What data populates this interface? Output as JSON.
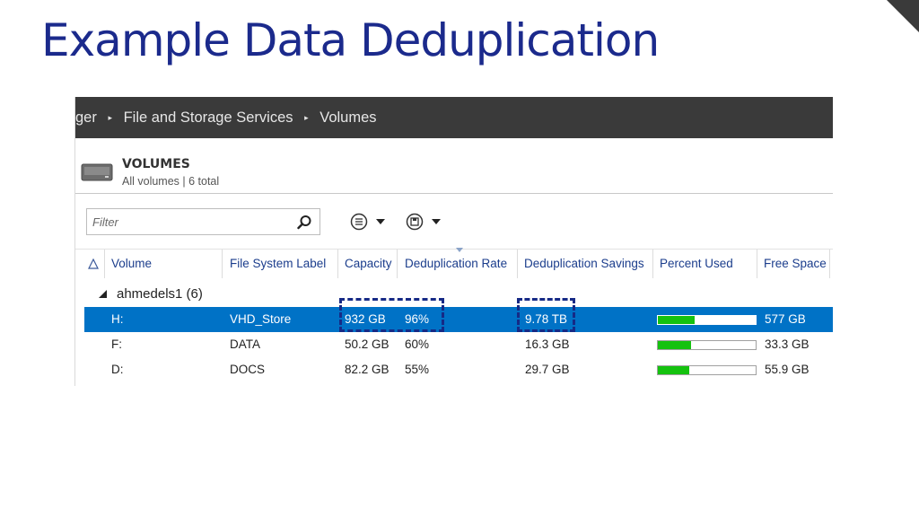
{
  "slide": {
    "title": "Example Data Deduplication"
  },
  "breadcrumb": {
    "items": [
      "ger",
      "File and Storage Services",
      "Volumes"
    ],
    "separator": "▸"
  },
  "volumes": {
    "title": "VOLUMES",
    "subtitle": "All volumes | 6 total"
  },
  "filter": {
    "placeholder": "Filter"
  },
  "toolbar": {
    "tasks_icon": "list-circle-icon",
    "save_icon": "save-circle-icon"
  },
  "columns": [
    "Volume",
    "File System Label",
    "Capacity",
    "Deduplication Rate",
    "Deduplication Savings",
    "Percent Used",
    "Free Space"
  ],
  "group": {
    "label": "ahmedels1 (6)"
  },
  "rows": [
    {
      "volume": "H:",
      "label": "VHD_Store",
      "capacity": "932 GB",
      "dedup_rate": "96%",
      "dedup_savings": "9.78 TB",
      "percent_used": 0.38,
      "free_space": "577 GB",
      "selected": true
    },
    {
      "volume": "F:",
      "label": "DATA",
      "capacity": "50.2 GB",
      "dedup_rate": "60%",
      "dedup_savings": "16.3 GB",
      "percent_used": 0.34,
      "free_space": "33.3 GB",
      "selected": false
    },
    {
      "volume": "D:",
      "label": "DOCS",
      "capacity": "82.2 GB",
      "dedup_rate": "55%",
      "dedup_savings": "29.7 GB",
      "percent_used": 0.32,
      "free_space": "55.9 GB",
      "selected": false
    }
  ],
  "colors": {
    "title": "#1b2a8c",
    "topbar": "#3a3a3a",
    "selection": "#0072c6",
    "bar_fill": "#15c20f",
    "column_header": "#1b3d8c",
    "callout": "#162a86"
  }
}
